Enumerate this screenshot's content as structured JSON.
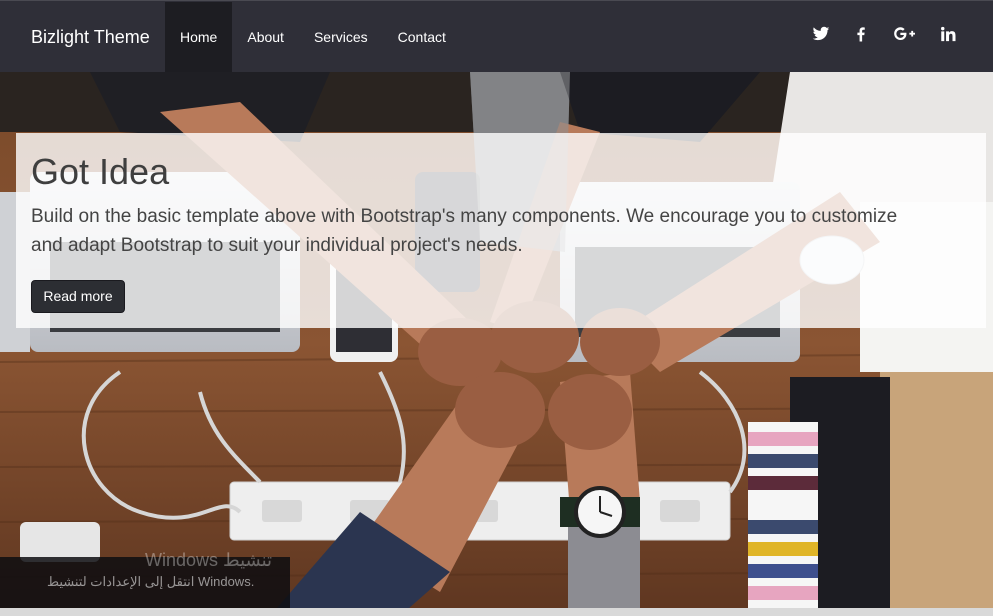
{
  "navbar": {
    "brand": "Bizlight Theme",
    "links": [
      {
        "label": "Home",
        "active": true
      },
      {
        "label": "About",
        "active": false
      },
      {
        "label": "Services",
        "active": false
      },
      {
        "label": "Contact",
        "active": false
      }
    ],
    "socials": [
      "twitter-icon",
      "facebook-icon",
      "google-plus-icon",
      "linkedin-icon"
    ],
    "background": "#2f2f38"
  },
  "jumbotron": {
    "title": "Got Idea",
    "text": "Build on the basic template above with Bootstrap's many components. We encourage you to customize and adapt Bootstrap to suit your individual project's needs.",
    "button_label": "Read more"
  },
  "watermark": {
    "line1": "Windows تنشيط",
    "line2": "انتقل إلى الإعدادات لتنشيط Windows."
  }
}
